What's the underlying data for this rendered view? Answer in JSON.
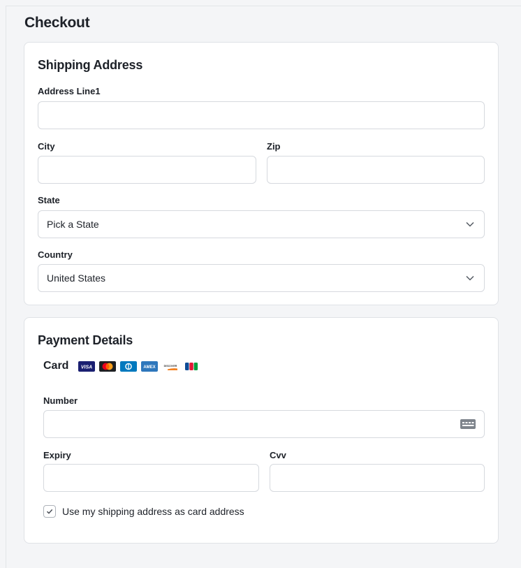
{
  "page": {
    "title": "Checkout"
  },
  "shipping": {
    "title": "Shipping Address",
    "address_line1": {
      "label": "Address Line1",
      "value": ""
    },
    "city": {
      "label": "City",
      "value": ""
    },
    "zip": {
      "label": "Zip",
      "value": ""
    },
    "state": {
      "label": "State",
      "value": "Pick a State"
    },
    "country": {
      "label": "Country",
      "value": "United States"
    }
  },
  "payment": {
    "title": "Payment Details",
    "card_label": "Card",
    "card_brands": [
      "VISA",
      "Mastercard",
      "Diners Club",
      "AMEX",
      "DISCOVER",
      "JCB"
    ],
    "number": {
      "label": "Number",
      "value": ""
    },
    "expiry": {
      "label": "Expiry",
      "value": ""
    },
    "cvv": {
      "label": "Cvv",
      "value": ""
    },
    "same_address": {
      "label": "Use my shipping address as card address",
      "checked": true
    }
  },
  "colors": {
    "background": "#f4f5f7",
    "card": "#ffffff",
    "border": "#dfe2e6",
    "visa": "#1a1f71",
    "amex": "#2e77bc",
    "diners": "#0079be",
    "mastercard_red": "#eb001b",
    "mastercard_yellow": "#f79e1b"
  }
}
